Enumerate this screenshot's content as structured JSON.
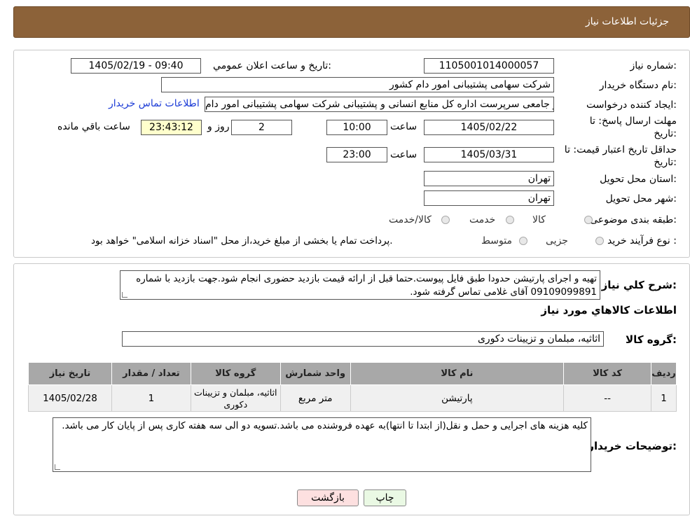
{
  "header": {
    "title": "جزئیات اطلاعات نیاز"
  },
  "form": {
    "need_number_label": "شماره نیاز:",
    "need_number": "1105001014000057",
    "announce_label": "تاریخ و ساعت اعلان عمومي:",
    "announce_value": "1405/02/19 - 09:40",
    "buyer_org_label": "نام دستگاه خريدار:",
    "buyer_org": "شرکت سهامی پشتیبانی امور دام کشور",
    "requester_label": "ایجاد کننده درخواست:",
    "requester": "فراز جامعی سرپرست اداره کل منابع انسانی و پشتیبانی شرکت سهامی پشتیبانی امور دام",
    "contact_link": "اطلاعات تماس خریدار",
    "deadline_label": "مهلت ارسال پاسخ: تا",
    "deadline_label2": "تاریخ:",
    "deadline_date": "1405/02/22",
    "time_label": "ساعت",
    "deadline_time": "10:00",
    "days_value": "2",
    "days_label": "روز و",
    "remaining_time": "23:43:12",
    "remaining_label": "ساعت باقي مانده",
    "validity_label": "حداقل تاریخ اعتبار قیمت: تا",
    "validity_label2": "تاریخ:",
    "validity_date": "1405/03/31",
    "validity_time": "23:00",
    "province_label": "استان محل تحویل:",
    "province": "تهران",
    "city_label": "شهر محل تحویل:",
    "city": "تهران",
    "category_label": "طبقه بندی موضوعی:",
    "category_options": [
      "کالا",
      "خدمت",
      "کالا/خدمت"
    ],
    "purchase_type_label": "نوع فرآیند خرید :",
    "purchase_options": [
      "جزیی",
      "متوسط"
    ],
    "purchase_note": "پرداخت تمام یا بخشی از مبلغ خرید،از محل \"اسناد خزانه اسلامی\" خواهد بود."
  },
  "details": {
    "summary_label": "شرح کلي نياز:",
    "summary": "تهیه و اجرای پارتیشن حدودا طبق فایل پیوست.حتما قبل از ارائه قیمت بازدید حضوری انجام شود.جهت بازدید با شماره 09109099891 آقای غلامی تماس گرفته شود.",
    "goods_info_title": "اطلاعات کالاهاي مورد نياز",
    "goods_group_label": "گروه کالا:",
    "goods_group": "اثاثیه، مبلمان و تزیینات دکوری",
    "table": {
      "headers": [
        "ردیف",
        "کد کالا",
        "نام کالا",
        "واحد شمارش",
        "گروه کالا",
        "تعداد / مقدار",
        "تاریخ نیاز"
      ],
      "rows": [
        [
          "1",
          "--",
          "پارتیشن",
          "متر مربع",
          "اثاثیه، مبلمان و تزیینات دکوری",
          "1",
          "1405/02/28"
        ]
      ]
    },
    "buyer_notes_label": "توضیحات خریدار:",
    "buyer_notes": "کلیه هزینه های اجرایی و حمل و نقل(از ابتدا تا انتها)به عهده فروشنده می باشد.تسویه دو الی سه هفته کاری پس از پایان کار می باشد."
  },
  "buttons": {
    "print": "چاپ",
    "back": "بازگشت"
  },
  "watermark": {
    "text": "AriaTender.neT"
  },
  "colors": {
    "header_bg": "#8c6239",
    "link": "#1a3ad6",
    "back_btn": "#fde0e0",
    "print_btn": "#eaf9e4"
  }
}
